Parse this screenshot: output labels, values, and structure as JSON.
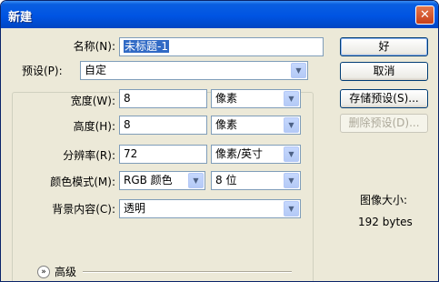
{
  "window": {
    "title": "新建",
    "close_glyph": "✕"
  },
  "name": {
    "label": "名称(N):",
    "value": "未标题-1"
  },
  "preset": {
    "label": "预设(P):",
    "value": "自定"
  },
  "width": {
    "label": "宽度(W):",
    "value": "8",
    "unit": "像素"
  },
  "height": {
    "label": "高度(H):",
    "value": "8",
    "unit": "像素"
  },
  "resolution": {
    "label": "分辨率(R):",
    "value": "72",
    "unit": "像素/英寸"
  },
  "color_mode": {
    "label": "颜色模式(M):",
    "mode": "RGB 颜色",
    "depth": "8 位"
  },
  "background": {
    "label": "背景内容(C):",
    "value": "透明"
  },
  "advanced": {
    "label": "高级"
  },
  "buttons": {
    "ok": "好",
    "cancel": "取消",
    "save_preset": "存储预设(S)...",
    "delete_preset": "删除预设(D)..."
  },
  "image_size": {
    "label": "图像大小:",
    "value": "192 bytes"
  },
  "icons": {
    "dropdown": "chevron-down-icon",
    "advanced": "double-chevron-icon",
    "close": "close-icon"
  },
  "colors": {
    "titlebar": "#0054e3",
    "selection": "#316ac5",
    "dialog_bg": "#ece9d8"
  }
}
